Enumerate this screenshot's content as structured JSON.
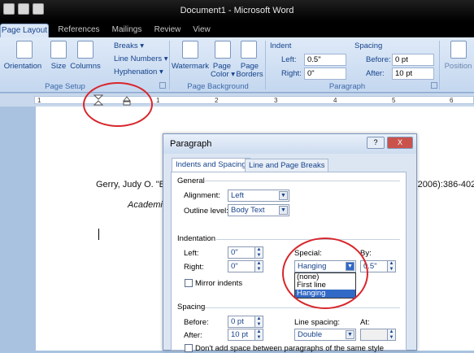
{
  "window": {
    "title": "Document1 - Microsoft Word"
  },
  "tabs": [
    "Page Layout",
    "References",
    "Mailings",
    "Review",
    "View"
  ],
  "ribbon": {
    "page_setup": {
      "orientation": "Orientation",
      "size": "Size",
      "columns": "Columns",
      "breaks": "Breaks ▾",
      "line_numbers": "Line Numbers ▾",
      "hyphenation": "Hyphenation ▾",
      "group_label": "Page Setup"
    },
    "page_background": {
      "watermark": "Watermark",
      "page_color_1": "Page",
      "page_color_2": "Color ▾",
      "page_borders_1": "Page",
      "page_borders_2": "Borders",
      "group_label": "Page Background"
    },
    "paragraph": {
      "indent_label": "Indent",
      "left_label": "Left:",
      "left_value": "0.5\"",
      "right_label": "Right:",
      "right_value": "0\"",
      "spacing_label": "Spacing",
      "before_label": "Before:",
      "before_value": "0 pt",
      "after_label": "After:",
      "after_value": "10 pt",
      "group_label": "Paragraph"
    },
    "arrange": {
      "position": "Position"
    }
  },
  "ruler": {
    "ticks": [
      "1",
      "1",
      "2",
      "3",
      "4",
      "5",
      "6"
    ]
  },
  "document": {
    "line1_left": "Gerry, Judy O. \"Ba",
    "line1_right": "(2006):386-402.",
    "line2": "Academic"
  },
  "dialog": {
    "title": "Paragraph",
    "help": "?",
    "close": "X",
    "tabs": [
      "Indents and Spacing",
      "Line and Page Breaks"
    ],
    "general": {
      "header": "General",
      "alignment_label": "Alignment:",
      "alignment_value": "Left",
      "outline_label": "Outline level:",
      "outline_value": "Body Text"
    },
    "indentation": {
      "header": "Indentation",
      "left_label": "Left:",
      "left_value": "0\"",
      "right_label": "Right:",
      "right_value": "0\"",
      "special_label": "Special:",
      "special_value": "Hanging",
      "by_label": "By:",
      "by_value": "0.5\"",
      "mirror_label": "Mirror indents",
      "special_options": [
        "(none)",
        "First line",
        "Hanging"
      ]
    },
    "spacing": {
      "header": "Spacing",
      "before_label": "Before:",
      "before_value": "0 pt",
      "after_label": "After:",
      "after_value": "10 pt",
      "line_spacing_label": "Line spacing:",
      "line_spacing_value": "Double",
      "at_label": "At:",
      "dont_add_label": "Don't add space between paragraphs of the same style"
    }
  }
}
